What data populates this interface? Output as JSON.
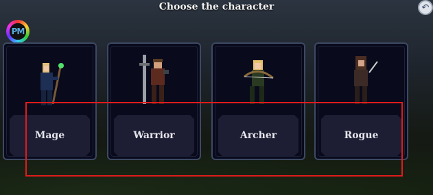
{
  "header": {
    "title": "Choose the character"
  },
  "logo": {
    "text": "PM"
  },
  "back_button": {
    "icon": "back-arrow-icon",
    "symbol": "↶"
  },
  "characters": [
    {
      "name": "Mage",
      "weapon": "staff"
    },
    {
      "name": "Warrior",
      "weapon": "greatsword"
    },
    {
      "name": "Archer",
      "weapon": "bow"
    },
    {
      "name": "Rogue",
      "weapon": "dagger"
    }
  ],
  "colors": {
    "card_bg": "#090a1c",
    "card_border": "#3d4963",
    "label_bg": "#1d1d33",
    "highlight": "#e01b1b"
  }
}
